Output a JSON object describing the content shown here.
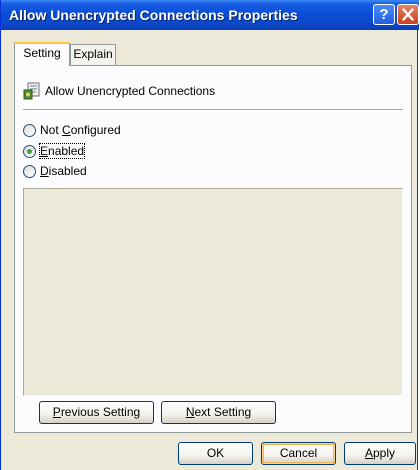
{
  "window": {
    "title": "Allow Unencrypted Connections Properties",
    "help_glyph": "?"
  },
  "tabs": [
    {
      "label": "Setting",
      "active": true
    },
    {
      "label": "Explain",
      "active": false
    }
  ],
  "policy": {
    "name": "Allow Unencrypted Connections",
    "icon": "policy-setting-icon"
  },
  "options": [
    {
      "pre": "Not ",
      "mnemonic": "C",
      "post": "onfigured",
      "selected": false
    },
    {
      "pre": "",
      "mnemonic": "E",
      "post": "nabled",
      "selected": true
    },
    {
      "pre": "",
      "mnemonic": "D",
      "post": "isabled",
      "selected": false
    }
  ],
  "nav_buttons": {
    "previous": {
      "mnemonic": "P",
      "rest": "revious Setting"
    },
    "next": {
      "mnemonic": "N",
      "rest": "ext Setting"
    }
  },
  "dialog_buttons": {
    "ok": "OK",
    "cancel": "Cancel",
    "apply": {
      "mnemonic": "A",
      "rest": "pply"
    }
  },
  "colors": {
    "title_bar": "#0A4FD8",
    "selected_radio": "#3DA031",
    "tab_highlight": "#FFC83C"
  }
}
